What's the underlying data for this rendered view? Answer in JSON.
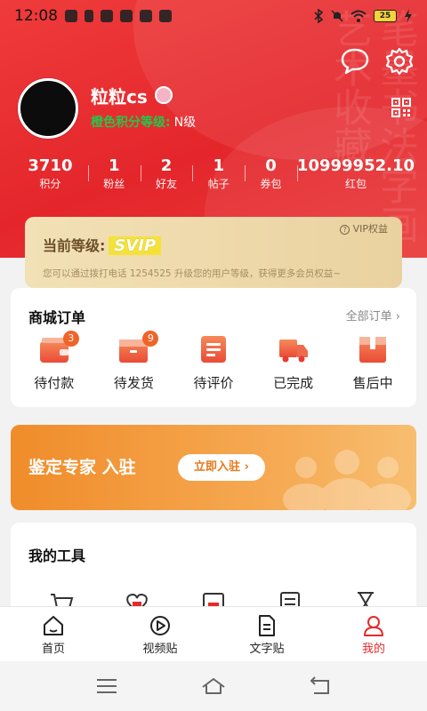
{
  "status_bar": {
    "time": "12:08",
    "battery": "25"
  },
  "profile": {
    "username": "粒粒cs",
    "level_label": "橙色积分等级:",
    "level_value": "N级"
  },
  "stats": [
    {
      "value": "3710",
      "label": "积分"
    },
    {
      "value": "1",
      "label": "粉丝"
    },
    {
      "value": "2",
      "label": "好友"
    },
    {
      "value": "1",
      "label": "帖子"
    },
    {
      "value": "0",
      "label": "券包"
    },
    {
      "value": "10999952.10",
      "label": "红包"
    }
  ],
  "vip": {
    "title": "当前等级:",
    "tag": "SVIP",
    "rights_link": "VIP权益",
    "description": "您可以通过拨打电话 1254525 升级您的用户等级，获得更多会员权益~"
  },
  "orders": {
    "title": "商城订单",
    "all_label": "全部订单",
    "items": [
      {
        "label": "待付款",
        "badge": "3",
        "icon": "wallet-icon"
      },
      {
        "label": "待发货",
        "badge": "9",
        "icon": "box-icon"
      },
      {
        "label": "待评价",
        "badge": "",
        "icon": "review-icon"
      },
      {
        "label": "已完成",
        "badge": "",
        "icon": "truck-icon"
      },
      {
        "label": "售后中",
        "badge": "",
        "icon": "aftersale-icon"
      }
    ]
  },
  "expert": {
    "title": "鉴定专家 入驻",
    "button": "立即入驻 ›"
  },
  "tools": {
    "title": "我的工具"
  },
  "nav": [
    {
      "label": "首页",
      "icon": "home-icon"
    },
    {
      "label": "视频贴",
      "icon": "video-icon"
    },
    {
      "label": "文字贴",
      "icon": "document-icon"
    },
    {
      "label": "我的",
      "icon": "profile-icon",
      "active": true
    }
  ],
  "colors": {
    "primary_red": "#e62a2a",
    "orange": "#f08c2a",
    "green": "#22c84a",
    "gold": "#f4e23a"
  }
}
